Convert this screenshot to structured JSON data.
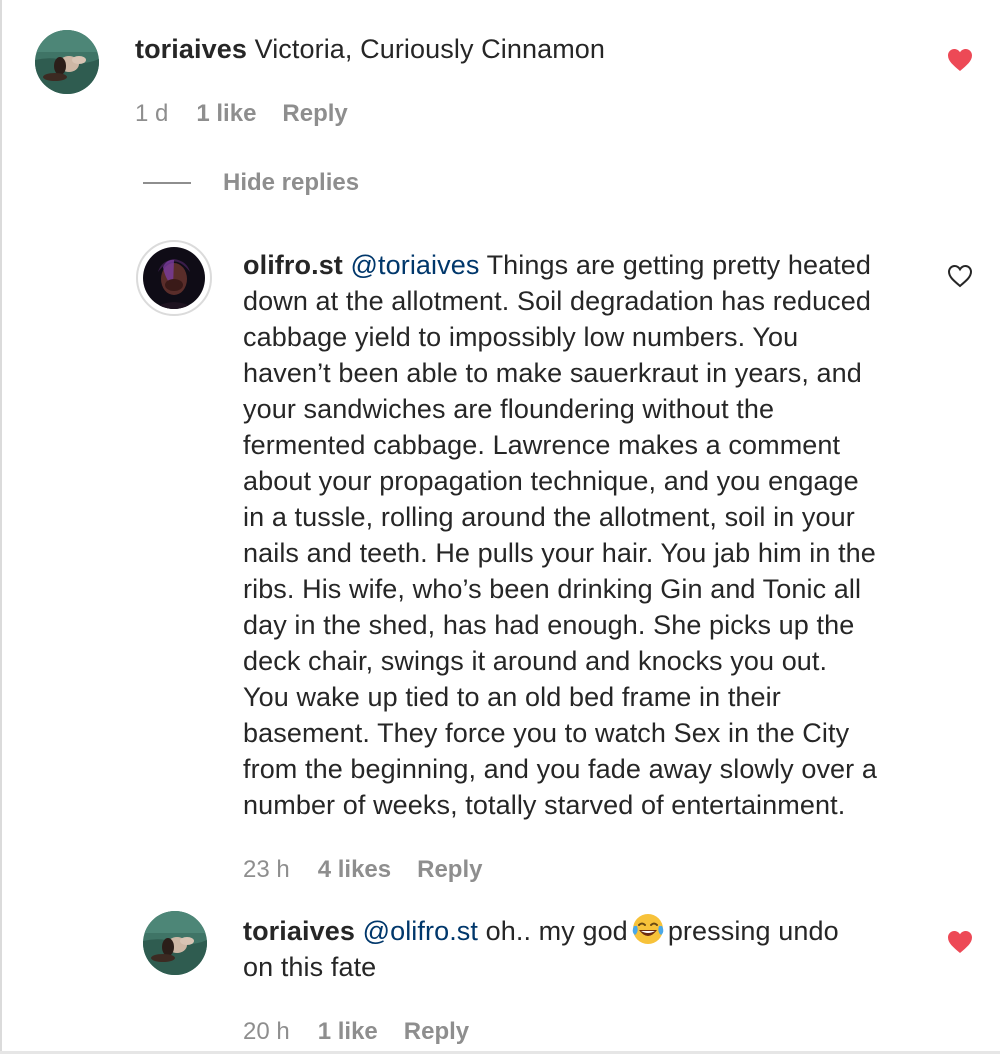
{
  "colors": {
    "text": "#262626",
    "muted": "#8e8e8e",
    "mention": "#00376b",
    "liked_heart": "#ed4956"
  },
  "comments": [
    {
      "username": "toriaives",
      "text": "Victoria, Curiously Cinnamon",
      "time": "1 d",
      "likes": "1 like",
      "reply_label": "Reply",
      "heart_icon": "heart-filled-icon",
      "liked": true
    }
  ],
  "thread": {
    "hide_replies_label": "Hide replies"
  },
  "replies": [
    {
      "username": "olifro.st",
      "mention": "@toriaives",
      "text_lines": [
        "Things are getting pretty heated",
        "down at the allotment. Soil degradation has reduced",
        "cabbage yield to impossibly low numbers. You",
        "haven’t been able to make sauerkraut in years, and",
        "your sandwiches are floundering without the",
        "fermented cabbage. Lawrence makes a comment",
        "about your propagation technique, and you engage",
        "in a tussle, rolling around the allotment, soil in your",
        "nails and teeth. He pulls your hair. You jab him in the",
        "ribs. His wife, who’s been drinking Gin and Tonic all",
        "day in the shed, has had enough. She picks up the",
        "deck chair, swings it around and knocks you out.",
        "You wake up tied to an old bed frame in their",
        "basement. They force you to watch Sex in the City",
        "from the beginning, and you fade away slowly over a",
        "number of weeks, totally starved of entertainment."
      ],
      "time": "23 h",
      "likes": "4 likes",
      "reply_label": "Reply",
      "heart_icon": "heart-outline-icon",
      "liked": false
    },
    {
      "username": "toriaives",
      "mention": "@olifro.st",
      "text_before_emoji": "oh.. my god",
      "emoji": "face-with-tears-of-joy-emoji",
      "text_after_emoji": "pressing undo",
      "text_line2": "on this fate",
      "time": "20 h",
      "likes": "1 like",
      "reply_label": "Reply",
      "heart_icon": "heart-filled-icon",
      "liked": true
    }
  ]
}
